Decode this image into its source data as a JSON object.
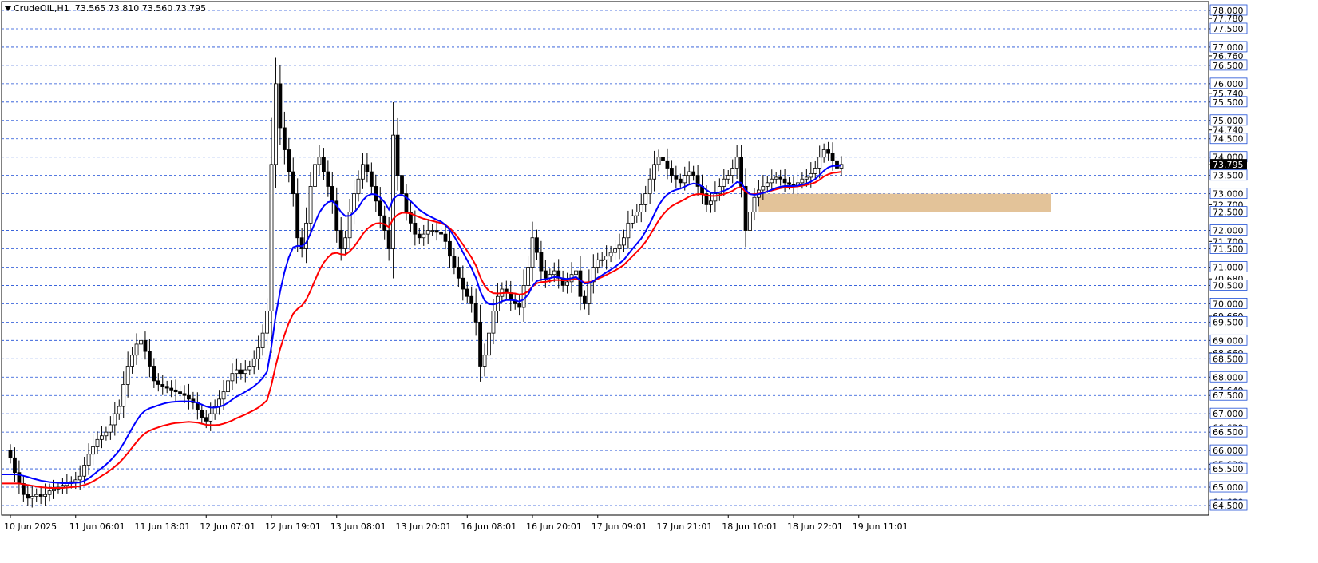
{
  "header": {
    "symbol_tf": "CrudeOIL,H1",
    "ohlc": "73.565 73.810 73.560 73.795"
  },
  "colors": {
    "bull_fill": "#ffffff",
    "bear_fill": "#000000",
    "ma_fast": "#0000ff",
    "ma_slow": "#ff0000",
    "zone": "#deb887",
    "grid": "#1f4fd6"
  },
  "chart_data": {
    "type": "candlestick",
    "ylim": [
      64.4,
      78.1
    ],
    "grid_lines": [
      78.0,
      77.5,
      77.0,
      76.5,
      76.0,
      75.5,
      75.0,
      74.5,
      74.0,
      73.5,
      73.0,
      72.5,
      72.0,
      71.5,
      71.0,
      70.5,
      70.0,
      69.5,
      69.0,
      68.5,
      68.0,
      67.5,
      67.0,
      66.5,
      66.0,
      65.5,
      65.0,
      64.5
    ],
    "y_tick_labels": [
      {
        "v": 78.0,
        "t": "78.000",
        "box": true
      },
      {
        "v": 77.78,
        "t": "77.780",
        "box": false
      },
      {
        "v": 77.5,
        "t": "77.500",
        "box": true
      },
      {
        "v": 77.0,
        "t": "77.000",
        "box": true
      },
      {
        "v": 76.76,
        "t": "76.760",
        "box": false
      },
      {
        "v": 76.5,
        "t": "76.500",
        "box": true
      },
      {
        "v": 76.0,
        "t": "76.000",
        "box": true
      },
      {
        "v": 75.74,
        "t": "75.740",
        "box": false
      },
      {
        "v": 75.5,
        "t": "75.500",
        "box": true
      },
      {
        "v": 75.0,
        "t": "75.000",
        "box": true
      },
      {
        "v": 74.74,
        "t": "74.740",
        "box": false
      },
      {
        "v": 74.5,
        "t": "74.500",
        "box": true
      },
      {
        "v": 74.0,
        "t": "74.000",
        "box": true
      },
      {
        "v": 73.795,
        "t": "73.795",
        "box": true,
        "current": true
      },
      {
        "v": 73.5,
        "t": "73.500",
        "box": true
      },
      {
        "v": 73.0,
        "t": "73.000",
        "box": true
      },
      {
        "v": 72.7,
        "t": "72.700",
        "box": false
      },
      {
        "v": 72.5,
        "t": "72.500",
        "box": true
      },
      {
        "v": 72.0,
        "t": "72.000",
        "box": true
      },
      {
        "v": 71.7,
        "t": "71.700",
        "box": false
      },
      {
        "v": 71.5,
        "t": "71.500",
        "box": true
      },
      {
        "v": 71.0,
        "t": "71.000",
        "box": true
      },
      {
        "v": 70.68,
        "t": "70.680",
        "box": false
      },
      {
        "v": 70.5,
        "t": "70.500",
        "box": true
      },
      {
        "v": 70.0,
        "t": "70.000",
        "box": true
      },
      {
        "v": 69.66,
        "t": "69.660",
        "box": false
      },
      {
        "v": 69.5,
        "t": "69.500",
        "box": true
      },
      {
        "v": 69.0,
        "t": "69.000",
        "box": true
      },
      {
        "v": 68.66,
        "t": "68.660",
        "box": false
      },
      {
        "v": 68.5,
        "t": "68.500",
        "box": true
      },
      {
        "v": 68.0,
        "t": "68.000",
        "box": true
      },
      {
        "v": 67.64,
        "t": "67.640",
        "box": false
      },
      {
        "v": 67.5,
        "t": "67.500",
        "box": true
      },
      {
        "v": 67.0,
        "t": "67.000",
        "box": true
      },
      {
        "v": 66.62,
        "t": "66.620",
        "box": false
      },
      {
        "v": 66.5,
        "t": "66.500",
        "box": true
      },
      {
        "v": 66.0,
        "t": "66.000",
        "box": true
      },
      {
        "v": 65.62,
        "t": "65.620",
        "box": false
      },
      {
        "v": 65.5,
        "t": "65.500",
        "box": true
      },
      {
        "v": 65.0,
        "t": "65.000",
        "box": true
      },
      {
        "v": 64.6,
        "t": "64.600",
        "box": false
      },
      {
        "v": 64.5,
        "t": "64.500",
        "box": true
      }
    ],
    "x_tick_labels": [
      {
        "bar": 0,
        "t": "10 Jun 2025"
      },
      {
        "bar": 15,
        "t": "11 Jun 06:01"
      },
      {
        "bar": 30,
        "t": "11 Jun 18:01"
      },
      {
        "bar": 45,
        "t": "12 Jun 07:01"
      },
      {
        "bar": 60,
        "t": "12 Jun 19:01"
      },
      {
        "bar": 75,
        "t": "13 Jun 08:01"
      },
      {
        "bar": 90,
        "t": "13 Jun 20:01"
      },
      {
        "bar": 105,
        "t": "16 Jun 08:01"
      },
      {
        "bar": 120,
        "t": "16 Jun 20:01"
      },
      {
        "bar": 135,
        "t": "17 Jun 09:01"
      },
      {
        "bar": 150,
        "t": "17 Jun 21:01"
      },
      {
        "bar": 165,
        "t": "18 Jun 10:01"
      },
      {
        "bar": 180,
        "t": "18 Jun 22:01"
      },
      {
        "bar": 195,
        "t": "19 Jun 11:01"
      }
    ],
    "closes": [
      65.8,
      65.4,
      65.1,
      64.8,
      64.7,
      64.75,
      64.8,
      64.75,
      64.8,
      64.9,
      64.95,
      65.0,
      65.05,
      65.1,
      65.15,
      65.2,
      65.3,
      65.6,
      65.9,
      66.1,
      66.3,
      66.4,
      66.5,
      66.7,
      67.0,
      67.2,
      67.8,
      68.3,
      68.6,
      68.9,
      69.0,
      68.7,
      68.3,
      67.9,
      67.8,
      67.75,
      67.7,
      67.65,
      67.6,
      67.55,
      67.5,
      67.4,
      67.3,
      67.1,
      66.9,
      66.8,
      67.0,
      67.2,
      67.4,
      67.6,
      67.9,
      68.1,
      68.2,
      68.1,
      68.2,
      68.3,
      68.5,
      68.8,
      69.2,
      69.8,
      73.8,
      76.0,
      74.8,
      74.2,
      73.6,
      73.0,
      71.8,
      71.5,
      72.2,
      73.2,
      73.8,
      74.0,
      73.6,
      73.2,
      72.8,
      72.0,
      71.5,
      71.8,
      72.5,
      73.0,
      73.4,
      73.8,
      73.6,
      73.2,
      72.8,
      72.4,
      72.0,
      71.5,
      74.6,
      73.5,
      73.0,
      72.5,
      72.2,
      71.9,
      71.8,
      71.9,
      72.0,
      72.0,
      71.95,
      71.9,
      71.7,
      71.3,
      71.0,
      70.7,
      70.4,
      70.2,
      70.0,
      69.5,
      68.3,
      68.6,
      69.2,
      69.8,
      70.2,
      70.4,
      70.3,
      70.1,
      70.0,
      69.9,
      70.5,
      71.0,
      71.8,
      71.4,
      70.9,
      70.7,
      70.8,
      70.9,
      70.7,
      70.5,
      70.6,
      70.8,
      70.9,
      70.2,
      70.0,
      70.6,
      71.0,
      71.2,
      71.2,
      71.3,
      71.4,
      71.5,
      71.6,
      71.8,
      72.2,
      72.4,
      72.5,
      72.7,
      73.0,
      73.4,
      73.8,
      74.0,
      73.9,
      73.7,
      73.5,
      73.4,
      73.3,
      73.5,
      73.6,
      73.5,
      73.2,
      73.0,
      72.7,
      72.8,
      73.0,
      73.2,
      73.4,
      73.5,
      73.7,
      74.0,
      73.2,
      72.0,
      72.5,
      72.9,
      73.1,
      73.2,
      73.3,
      73.4,
      73.45,
      73.4,
      73.3,
      73.25,
      73.2,
      73.3,
      73.4,
      73.45,
      73.55,
      73.7,
      74.0,
      74.2,
      74.1,
      73.9,
      73.7,
      73.8
    ],
    "ma_fast": [
      65.35,
      65.35,
      65.34,
      65.31,
      65.28,
      65.24,
      65.21,
      65.18,
      65.16,
      65.14,
      65.13,
      65.12,
      65.11,
      65.11,
      65.11,
      65.12,
      65.13,
      65.17,
      65.24,
      65.33,
      65.43,
      65.52,
      65.62,
      65.73,
      65.86,
      66.0,
      66.19,
      66.4,
      66.61,
      66.81,
      66.98,
      67.09,
      67.15,
      67.19,
      67.23,
      67.27,
      67.3,
      67.32,
      67.33,
      67.34,
      67.34,
      67.34,
      67.33,
      67.3,
      67.25,
      67.2,
      67.17,
      67.17,
      67.19,
      67.23,
      67.3,
      67.39,
      67.47,
      67.53,
      67.6,
      67.67,
      67.75,
      67.85,
      67.98,
      68.15,
      68.84,
      69.69,
      70.34,
      70.87,
      71.27,
      71.54,
      71.58,
      71.57,
      71.67,
      71.92,
      72.21,
      72.48,
      72.66,
      72.77,
      72.8,
      72.68,
      72.5,
      72.39,
      72.4,
      72.49,
      72.63,
      72.82,
      72.94,
      72.99,
      72.98,
      72.9,
      72.77,
      72.57,
      72.86,
      72.96,
      72.97,
      72.9,
      72.8,
      72.68,
      72.56,
      72.48,
      72.41,
      72.35,
      72.29,
      72.24,
      72.15,
      72.01,
      71.84,
      71.63,
      71.41,
      71.19,
      70.97,
      70.71,
      70.34,
      70.09,
      69.99,
      69.98,
      70.01,
      70.07,
      70.1,
      70.1,
      70.09,
      70.06,
      70.12,
      70.25,
      70.48,
      70.62,
      70.66,
      70.67,
      70.7,
      70.73,
      70.72,
      70.69,
      70.68,
      70.7,
      70.73,
      70.64,
      70.55,
      70.56,
      70.62,
      70.71,
      70.78,
      70.86,
      70.93,
      71.01,
      71.1,
      71.2,
      71.35,
      71.5,
      71.64,
      71.78,
      71.97,
      72.19,
      72.44,
      72.68,
      72.86,
      72.98,
      73.06,
      73.11,
      73.14,
      73.19,
      73.25,
      73.28,
      73.26,
      73.2,
      73.1,
      73.03,
      73.02,
      73.04,
      73.08,
      73.13,
      73.21,
      73.32,
      73.3,
      73.1,
      72.99,
      72.97,
      72.99,
      73.02,
      73.06,
      73.11,
      73.16,
      73.19,
      73.21,
      73.21,
      73.21,
      73.22,
      73.25,
      73.28,
      73.33,
      73.4,
      73.51,
      73.63,
      73.72,
      73.76,
      73.76,
      73.77
    ],
    "ma_slow": [
      65.1,
      65.1,
      65.1,
      65.08,
      65.06,
      65.04,
      65.02,
      65.0,
      64.99,
      64.98,
      64.98,
      64.98,
      64.98,
      64.99,
      65.0,
      65.01,
      65.03,
      65.06,
      65.1,
      65.16,
      65.23,
      65.31,
      65.38,
      65.47,
      65.56,
      65.66,
      65.79,
      65.93,
      66.08,
      66.23,
      66.37,
      66.47,
      66.54,
      66.59,
      66.63,
      66.67,
      66.7,
      66.73,
      66.75,
      66.76,
      66.77,
      66.78,
      66.77,
      66.76,
      66.73,
      66.7,
      66.69,
      66.69,
      66.7,
      66.73,
      66.77,
      66.82,
      66.88,
      66.93,
      66.98,
      67.04,
      67.1,
      67.17,
      67.26,
      67.37,
      67.79,
      68.32,
      68.77,
      69.15,
      69.48,
      69.73,
      69.86,
      69.95,
      70.11,
      70.36,
      70.64,
      70.91,
      71.12,
      71.27,
      71.37,
      71.39,
      71.35,
      71.34,
      71.43,
      71.56,
      71.72,
      71.9,
      72.04,
      72.13,
      72.19,
      72.2,
      72.17,
      72.09,
      72.32,
      72.43,
      72.48,
      72.48,
      72.46,
      72.41,
      72.36,
      72.32,
      72.29,
      72.26,
      72.23,
      72.2,
      72.15,
      72.06,
      71.94,
      71.79,
      71.62,
      71.44,
      71.26,
      71.04,
      70.73,
      70.49,
      70.35,
      70.29,
      70.28,
      70.29,
      70.3,
      70.29,
      70.28,
      70.25,
      70.27,
      70.34,
      70.47,
      70.56,
      70.59,
      70.6,
      70.62,
      70.65,
      70.65,
      70.64,
      70.64,
      70.66,
      70.68,
      70.64,
      70.58,
      70.59,
      70.62,
      70.68,
      70.73,
      70.79,
      70.85,
      70.91,
      70.98,
      71.06,
      71.18,
      71.3,
      71.42,
      71.54,
      71.69,
      71.87,
      72.07,
      72.27,
      72.43,
      72.56,
      72.66,
      72.73,
      72.79,
      72.85,
      72.92,
      72.97,
      72.99,
      72.99,
      72.96,
      72.94,
      72.94,
      72.96,
      72.99,
      73.03,
      73.08,
      73.16,
      73.17,
      73.05,
      72.99,
      72.99,
      73.0,
      73.03,
      73.06,
      73.09,
      73.12,
      73.15,
      73.17,
      73.18,
      73.19,
      73.2,
      73.22,
      73.24,
      73.27,
      73.31,
      73.38,
      73.47,
      73.53,
      73.57,
      73.58,
      73.6
    ],
    "zone": {
      "from_bar": 172,
      "to_bar": 245,
      "low": 72.5,
      "high": 73.0
    }
  }
}
